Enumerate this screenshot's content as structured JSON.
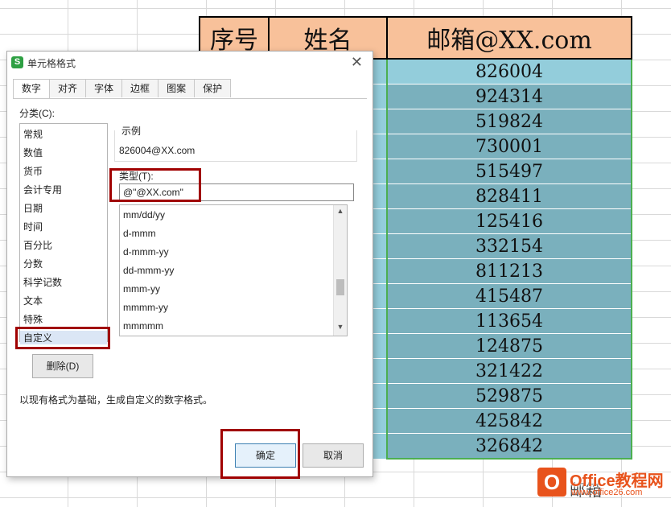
{
  "sheet": {
    "headers": [
      "序号",
      "姓名",
      "邮箱@XX.com"
    ],
    "emails": [
      "826004",
      "924314",
      "519824",
      "730001",
      "515497",
      "828411",
      "125416",
      "332154",
      "811213",
      "415487",
      "113654",
      "124875",
      "321422",
      "529875",
      "425842",
      "326842"
    ],
    "bottom_partial_text": "邮箱",
    "colors": {
      "header": "#f8c19a",
      "cell": "#7ab0bd",
      "cell_light": "#93cddb",
      "selection": "#4caf50"
    }
  },
  "dialog": {
    "title": "单元格格式",
    "app_icon_label": "S",
    "tabs": [
      "数字",
      "对齐",
      "字体",
      "边框",
      "图案",
      "保护"
    ],
    "active_tab": "数字",
    "category_label": "分类(C):",
    "categories": [
      "常规",
      "数值",
      "货币",
      "会计专用",
      "日期",
      "时间",
      "百分比",
      "分数",
      "科学记数",
      "文本",
      "特殊",
      "自定义"
    ],
    "selected_category": "自定义",
    "sample_label": "示例",
    "sample_value": "826004@XX.com",
    "type_label": "类型(T):",
    "type_value": "@\"@XX.com\"",
    "formats": [
      "mm/dd/yy",
      "d-mmm",
      "d-mmm-yy",
      "dd-mmm-yy",
      "mmm-yy",
      "mmmm-yy",
      "mmmmm"
    ],
    "delete_button": "删除(D)",
    "description": "以现有格式为基础，生成自定义的数字格式。",
    "ok_button": "确定",
    "cancel_button": "取消",
    "highlight_color": "#a00000"
  },
  "watermark": {
    "brand": "Office教程网",
    "url": "www.office26.com"
  }
}
